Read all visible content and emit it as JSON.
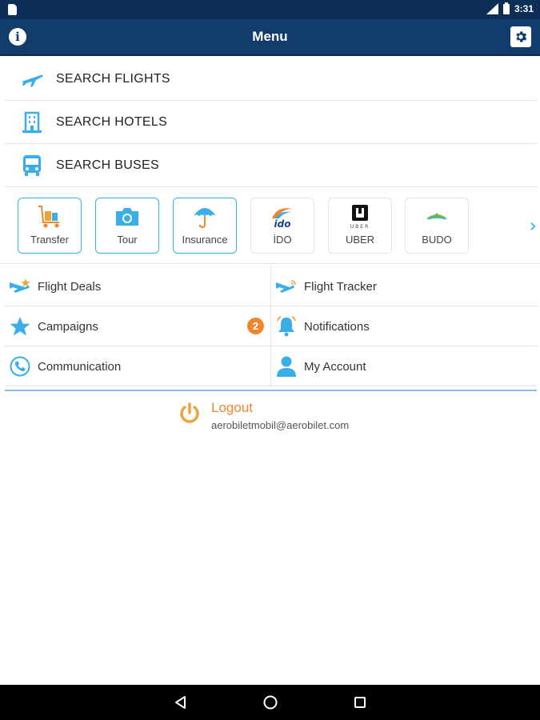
{
  "status_bar": {
    "time": "3:31"
  },
  "app_bar": {
    "title": "Menu"
  },
  "search_rows": [
    {
      "label": "SEARCH FLIGHTS",
      "icon": "plane-icon"
    },
    {
      "label": "SEARCH HOTELS",
      "icon": "hotel-icon"
    },
    {
      "label": "SEARCH BUSES",
      "icon": "bus-icon"
    }
  ],
  "tiles": [
    {
      "label": "Transfer",
      "icon": "luggage-cart-icon"
    },
    {
      "label": "Tour",
      "icon": "camera-icon"
    },
    {
      "label": "Insurance",
      "icon": "umbrella-icon"
    },
    {
      "label": "İDO",
      "logo_text": "ido"
    },
    {
      "label": "UBER",
      "logo_text": "UBER"
    },
    {
      "label": "BUDO",
      "icon": "budo-logo-icon"
    }
  ],
  "grid": {
    "flight_deals": "Flight Deals",
    "flight_tracker": "Flight Tracker",
    "campaigns": "Campaigns",
    "notifications": "Notifications",
    "notifications_badge": "2",
    "communication": "Communication",
    "my_account": "My Account"
  },
  "logout": {
    "label": "Logout",
    "email": "aerobiletmobil@aerobilet.com"
  },
  "colors": {
    "app_bar": "#123c6b",
    "accent_blue": "#39aee9",
    "accent_orange": "#f0862d"
  }
}
